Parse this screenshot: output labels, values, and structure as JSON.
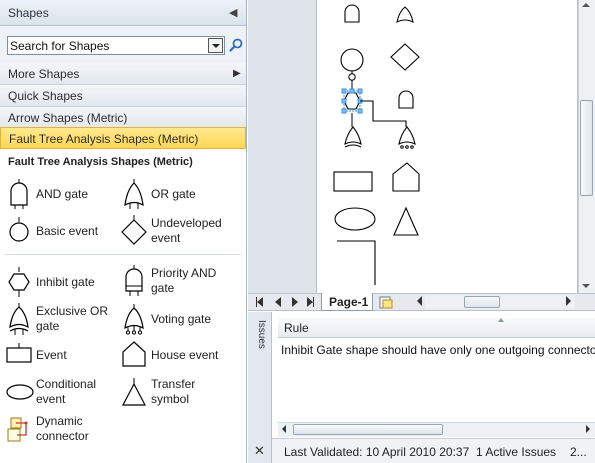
{
  "shapes_panel": {
    "title": "Shapes",
    "search_placeholder": "Search for Shapes",
    "stencils": [
      {
        "label": "More Shapes"
      },
      {
        "label": "Quick Shapes"
      },
      {
        "label": "Arrow Shapes (Metric)"
      },
      {
        "label": "Fault Tree Analysis Shapes (Metric)"
      }
    ],
    "stencil_title": "Fault Tree Analysis Shapes (Metric)",
    "shapes": [
      {
        "label": "AND gate",
        "icon": "and-gate-icon"
      },
      {
        "label": "OR gate",
        "icon": "or-gate-icon"
      },
      {
        "label": "Basic event",
        "icon": "basic-event-icon"
      },
      {
        "label": "Undeveloped event",
        "line1": "Undeveloped",
        "line2": "event",
        "icon": "undeveloped-event-icon"
      },
      {
        "label": "Inhibit gate",
        "icon": "inhibit-gate-icon"
      },
      {
        "label": "Priority AND gate",
        "line1": "Priority AND",
        "line2": "gate",
        "icon": "priority-and-gate-icon"
      },
      {
        "label": "Exclusive OR gate",
        "line1": "Exclusive OR",
        "line2": "gate",
        "icon": "exclusive-or-gate-icon"
      },
      {
        "label": "Voting gate",
        "icon": "voting-gate-icon"
      },
      {
        "label": "Event",
        "icon": "event-icon"
      },
      {
        "label": "House event",
        "icon": "house-event-icon"
      },
      {
        "label": "Conditional event",
        "line1": "Conditional",
        "line2": "event",
        "icon": "conditional-event-icon"
      },
      {
        "label": "Transfer symbol",
        "line1": "Transfer",
        "line2": "symbol",
        "icon": "transfer-symbol-icon"
      },
      {
        "label": "Dynamic connector",
        "line1": "Dynamic",
        "line2": "connector",
        "icon": "dynamic-connector-icon"
      }
    ]
  },
  "drawing": {
    "page_tab": "Page-1"
  },
  "issues": {
    "side_label": "Issues",
    "column_rule": "Rule",
    "rows": [
      {
        "rule": "Inhibit Gate shape should have only one outgoing connector."
      }
    ],
    "status": {
      "last_validated": "Last Validated: 10 April 2010 20:37",
      "active_issues": "1 Active Issues",
      "extra": "2..."
    }
  },
  "colors": {
    "active_stencil": "#ffd754",
    "selection": "#3b8fe0"
  }
}
